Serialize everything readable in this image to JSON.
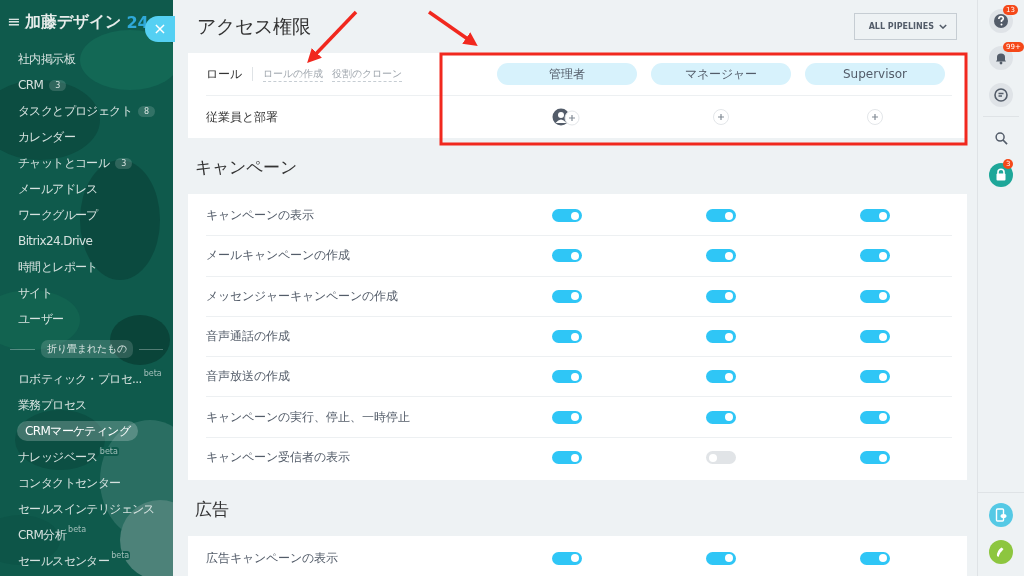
{
  "sidebar": {
    "menu_icon": "≡",
    "logo": {
      "title": "加藤デザイン",
      "suffix": "24"
    },
    "close_button": "×",
    "items": [
      {
        "label": "社内掲示板",
        "selected": false
      },
      {
        "label": "CRM",
        "counter": "3",
        "selected": false
      },
      {
        "label": "タスクとプロジェクト",
        "counter": "8",
        "selected": false
      },
      {
        "label": "カレンダー",
        "selected": false
      },
      {
        "label": "チャットとコール",
        "counter": "3",
        "selected": false
      },
      {
        "label": "メールアドレス",
        "selected": false
      },
      {
        "label": "ワークグループ",
        "selected": false
      },
      {
        "label": "Bitrix24.Drive",
        "selected": false
      },
      {
        "label": "時間とレポート",
        "selected": false
      },
      {
        "label": "サイト",
        "selected": false
      },
      {
        "label": "ユーザー",
        "selected": false
      }
    ],
    "collapsed_label": "折り畳まれたもの",
    "collapsed_items": [
      {
        "label": "ロボティック・プロセ...",
        "beta": "beta",
        "selected": false
      },
      {
        "label": "業務プロセス",
        "selected": false
      },
      {
        "label": "CRMマーケティング",
        "selected": true
      },
      {
        "label": "ナレッジベース",
        "beta": "beta",
        "selected": false
      },
      {
        "label": "コンタクトセンター",
        "selected": false
      },
      {
        "label": "セールスインテリジェンス",
        "selected": false
      },
      {
        "label": "CRM分析",
        "beta": "beta",
        "selected": false
      },
      {
        "label": "セールスセンター",
        "beta": "beta",
        "selected": false
      }
    ]
  },
  "page": {
    "title": "アクセス権限",
    "pipeline_button": "ALL PIPELINES",
    "roles": {
      "label": "ロール",
      "links": [
        "ロールの作成",
        "役割のクローン"
      ],
      "roles": [
        "管理者",
        "マネージャー",
        "Supervisor"
      ]
    },
    "members": {
      "label": "従業員と部署",
      "cells": [
        {
          "assigned": true
        },
        {
          "assigned": false
        },
        {
          "assigned": false
        }
      ]
    },
    "sections": [
      {
        "title": "キャンペーン",
        "rows": [
          {
            "label": "キャンペーンの表示",
            "permissions": [
              {
                "on": true
              },
              {
                "on": true
              },
              {
                "on": true
              }
            ]
          },
          {
            "label": "メールキャンペーンの作成",
            "permissions": [
              {
                "on": true
              },
              {
                "on": true
              },
              {
                "on": true
              }
            ]
          },
          {
            "label": "メッセンジャーキャンペーンの作成",
            "permissions": [
              {
                "on": true
              },
              {
                "on": true
              },
              {
                "on": true
              }
            ]
          },
          {
            "label": "音声通話の作成",
            "permissions": [
              {
                "on": true
              },
              {
                "on": true
              },
              {
                "on": true
              }
            ]
          },
          {
            "label": "音声放送の作成",
            "permissions": [
              {
                "on": true
              },
              {
                "on": true
              },
              {
                "on": true
              }
            ]
          },
          {
            "label": "キャンペーンの実行、停止、一時停止",
            "permissions": [
              {
                "on": true
              },
              {
                "on": true
              },
              {
                "on": true
              }
            ]
          },
          {
            "label": "キャンペーン受信者の表示",
            "permissions": [
              {
                "on": true
              },
              {
                "on": false
              },
              {
                "on": true
              }
            ]
          }
        ]
      },
      {
        "title": "広告",
        "rows": [
          {
            "label": "広告キャンペーンの表示",
            "permissions": [
              {
                "on": true
              },
              {
                "on": true
              },
              {
                "on": true
              }
            ]
          }
        ]
      }
    ]
  },
  "right_rail": {
    "top": [
      {
        "kind": "help",
        "badge": "13"
      },
      {
        "kind": "bell",
        "badge": "99+"
      },
      {
        "kind": "chat"
      },
      {
        "kind": "search"
      },
      {
        "kind": "lock",
        "badge": "3"
      }
    ],
    "bottom": [
      {
        "kind": "device"
      },
      {
        "kind": "phone"
      }
    ]
  }
}
